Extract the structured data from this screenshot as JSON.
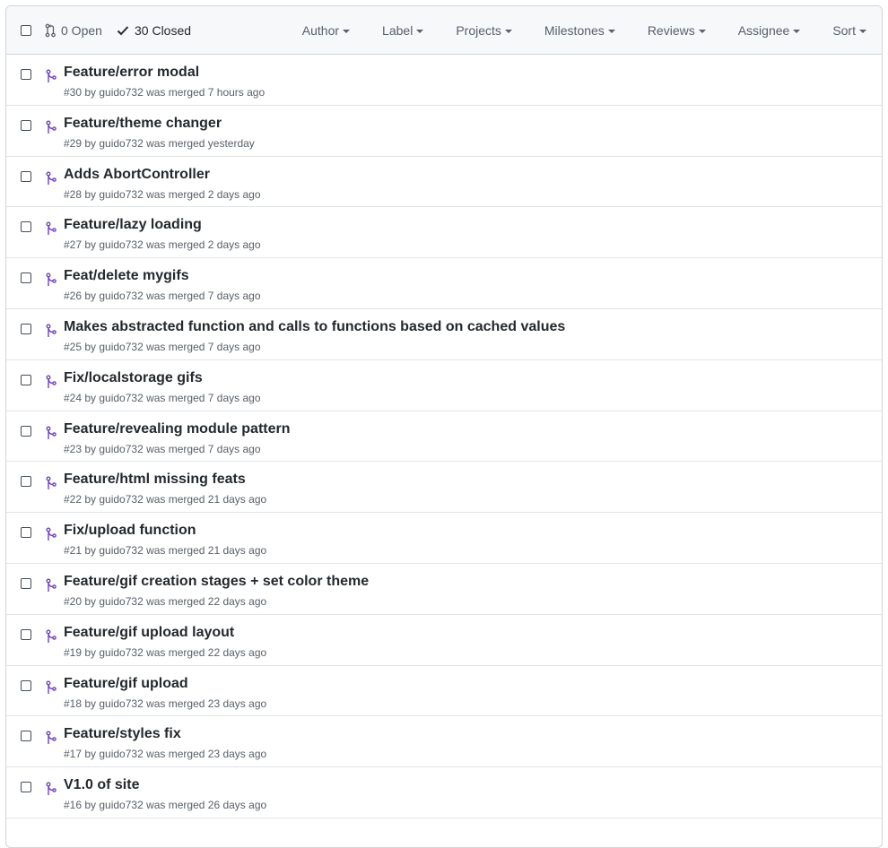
{
  "header": {
    "open_label": "0 Open",
    "closed_label": "30 Closed",
    "filters": [
      {
        "label": "Author"
      },
      {
        "label": "Label"
      },
      {
        "label": "Projects"
      },
      {
        "label": "Milestones"
      },
      {
        "label": "Reviews"
      },
      {
        "label": "Assignee"
      },
      {
        "label": "Sort"
      }
    ]
  },
  "colors": {
    "merged_icon": "#6f42c1",
    "text": "#24292e",
    "muted": "#586069",
    "border": "#e1e4e8",
    "header_bg": "#f6f8fa"
  },
  "icons": {
    "open": "git-pull-request-icon",
    "closed": "check-icon",
    "row": "git-merge-icon"
  },
  "pulls": [
    {
      "title": "Feature/error modal",
      "meta": "#30 by guido732 was merged 7 hours ago"
    },
    {
      "title": "Feature/theme changer",
      "meta": "#29 by guido732 was merged yesterday"
    },
    {
      "title": "Adds AbortController",
      "meta": "#28 by guido732 was merged 2 days ago"
    },
    {
      "title": "Feature/lazy loading",
      "meta": "#27 by guido732 was merged 2 days ago"
    },
    {
      "title": "Feat/delete mygifs",
      "meta": "#26 by guido732 was merged 7 days ago"
    },
    {
      "title": "Makes abstracted function and calls to functions based on cached values",
      "meta": "#25 by guido732 was merged 7 days ago"
    },
    {
      "title": "Fix/localstorage gifs",
      "meta": "#24 by guido732 was merged 7 days ago"
    },
    {
      "title": "Feature/revealing module pattern",
      "meta": "#23 by guido732 was merged 7 days ago"
    },
    {
      "title": "Feature/html missing feats",
      "meta": "#22 by guido732 was merged 21 days ago"
    },
    {
      "title": "Fix/upload function",
      "meta": "#21 by guido732 was merged 21 days ago"
    },
    {
      "title": "Feature/gif creation stages + set color theme",
      "meta": "#20 by guido732 was merged 22 days ago"
    },
    {
      "title": "Feature/gif upload layout",
      "meta": "#19 by guido732 was merged 22 days ago"
    },
    {
      "title": "Feature/gif upload",
      "meta": "#18 by guido732 was merged 23 days ago"
    },
    {
      "title": "Feature/styles fix",
      "meta": "#17 by guido732 was merged 23 days ago"
    },
    {
      "title": "V1.0 of site",
      "meta": "#16 by guido732 was merged 26 days ago"
    }
  ]
}
